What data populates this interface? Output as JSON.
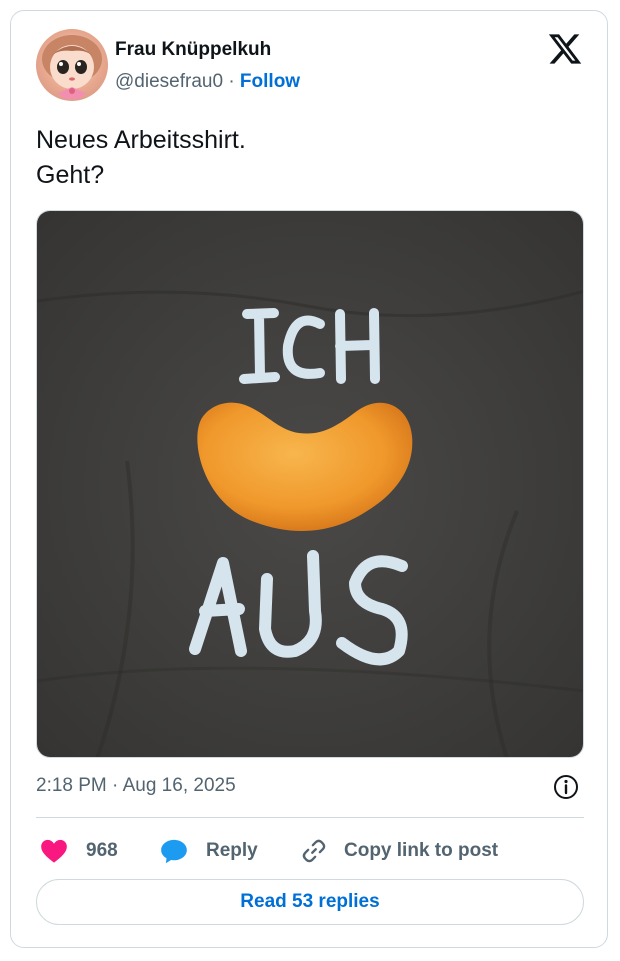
{
  "author": {
    "name": "Frau Knüppelkuh",
    "handle": "@diesefrau0",
    "separator": "·",
    "follow_label": "Follow"
  },
  "tweet": {
    "lines": [
      "Neues Arbeitsshirt.",
      "Geht?"
    ],
    "shirt_text_top": "ICH",
    "shirt_text_bottom": "AUS",
    "timestamp": "2:18 PM · Aug 16, 2025"
  },
  "actions": {
    "like_count": "968",
    "reply_label": "Reply",
    "copy_label": "Copy link to post"
  },
  "read_replies_label": "Read 53 replies",
  "icons": {
    "logo": "x-logo-icon",
    "info": "info-icon",
    "like": "heart-icon",
    "reply": "speech-bubble-icon",
    "copy": "link-icon"
  },
  "colors": {
    "accent": "#006fd6",
    "like": "#f91880",
    "reply": "#1d9bf0",
    "muted": "#536471",
    "shirt": "#3f3e3c",
    "heart_snack": "#f2a33a"
  }
}
